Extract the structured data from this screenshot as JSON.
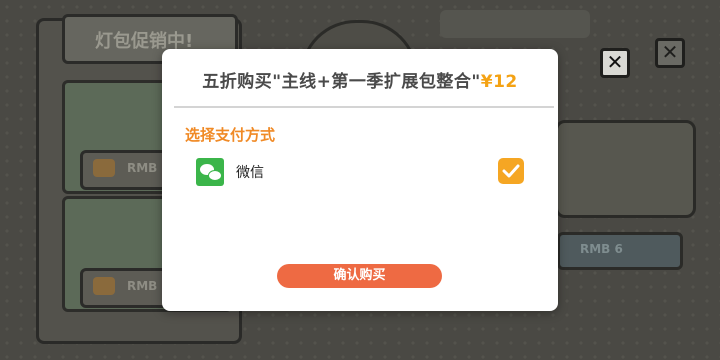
{
  "background": {
    "left_banner_text": "灯包促销中!",
    "left_price_1": "RMB",
    "left_price_2": "RMB",
    "right_price": "RMB 6"
  },
  "dialog": {
    "title_prefix": "五折购买\"主线+第一季扩展包整合\"",
    "title_price": "¥12",
    "payment_heading": "选择支付方式",
    "payment_options": [
      {
        "label": "微信",
        "icon": "wechat-icon",
        "selected": true
      }
    ],
    "confirm_label": "确认购买"
  },
  "colors": {
    "accent_orange": "#f08a26",
    "confirm_button": "#ee6a43",
    "checkbox": "#f5a623",
    "wechat_green": "#3bb54a",
    "price_yellow": "#f4a213"
  }
}
